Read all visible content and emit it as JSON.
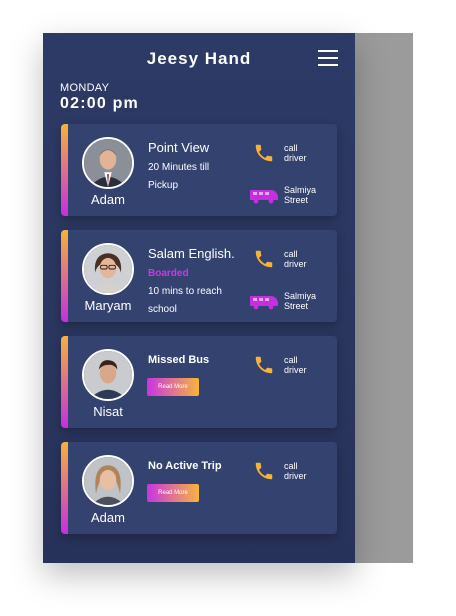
{
  "app": {
    "title": "Jeesy Hand"
  },
  "header": {
    "day": "MONDAY",
    "time": "02:00 pm"
  },
  "colors": {
    "accent_purple": "#c52fe0",
    "accent_yellow": "#f6b23a",
    "background": "#2d3a66"
  },
  "cards": [
    {
      "name": "Adam",
      "title": "Point View",
      "line1": "20 Minutes till",
      "line2": "Pickup",
      "call_line1": "call",
      "call_line2": "driver",
      "location_line1": "Salmiya",
      "location_line2": "Street"
    },
    {
      "name": "Maryam",
      "title": "Salam English.",
      "status": "Boarded",
      "line1": "10 mins to reach",
      "line2": "school",
      "call_line1": "call",
      "call_line2": "driver",
      "location_line1": "Salmiya",
      "location_line2": "Street"
    },
    {
      "name": "Nisat",
      "title": "Missed Bus",
      "button": "Read More",
      "call_line1": "call",
      "call_line2": "driver"
    },
    {
      "name": "Adam",
      "title": "No Active Trip",
      "button": "Read More",
      "call_line1": "call",
      "call_line2": "driver"
    }
  ]
}
